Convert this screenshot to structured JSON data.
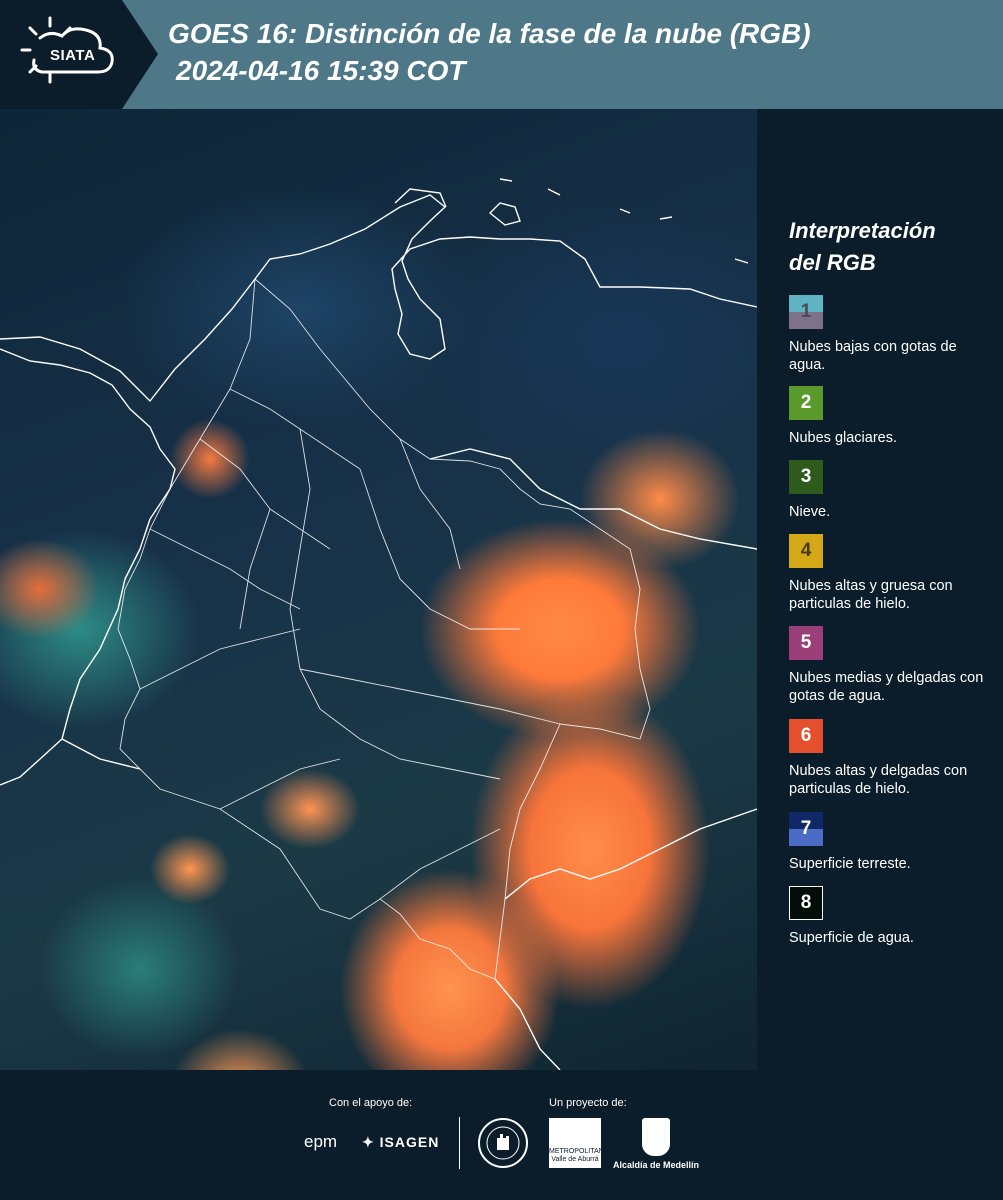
{
  "header": {
    "logo_text": "SIATA",
    "title_line1": "GOES 16: Distinción de la fase de la nube (RGB)",
    "title_line2": "2024-04-16 15:39 COT"
  },
  "legend": {
    "title_line1": "Interpretación",
    "title_line2": "del RGB",
    "items": [
      {
        "number": "1",
        "label": "Nubes bajas con gotas de agua.",
        "color_top": "#5eb4c2",
        "color_bottom": "#7e7288"
      },
      {
        "number": "2",
        "label": "Nubes glaciares.",
        "color": "#5a9a2a"
      },
      {
        "number": "3",
        "label": "Nieve.",
        "color": "#2e5a1c"
      },
      {
        "number": "4",
        "label": "Nubes altas y gruesa con particulas de hielo.",
        "color": "#d4a817"
      },
      {
        "number": "5",
        "label": "Nubes medias y delgadas con gotas de agua.",
        "color": "#9a3f78"
      },
      {
        "number": "6",
        "label": "Nubes altas y delgadas con particulas de hielo.",
        "color": "#e4502d"
      },
      {
        "number": "7",
        "label": "Superficie terreste.",
        "color_top": "#102866",
        "color_bottom": "#4a6cc4"
      },
      {
        "number": "8",
        "label": "Superficie de agua.",
        "color": "#040e08"
      }
    ]
  },
  "footer": {
    "support_label": "Con el apoyo de:",
    "project_label": "Un proyecto de:",
    "epm": "epm",
    "isagen": "ISAGEN",
    "area_text": "METROPOLITANA Valle de Aburrá",
    "medellin": "Alcaldía de Medellín"
  }
}
